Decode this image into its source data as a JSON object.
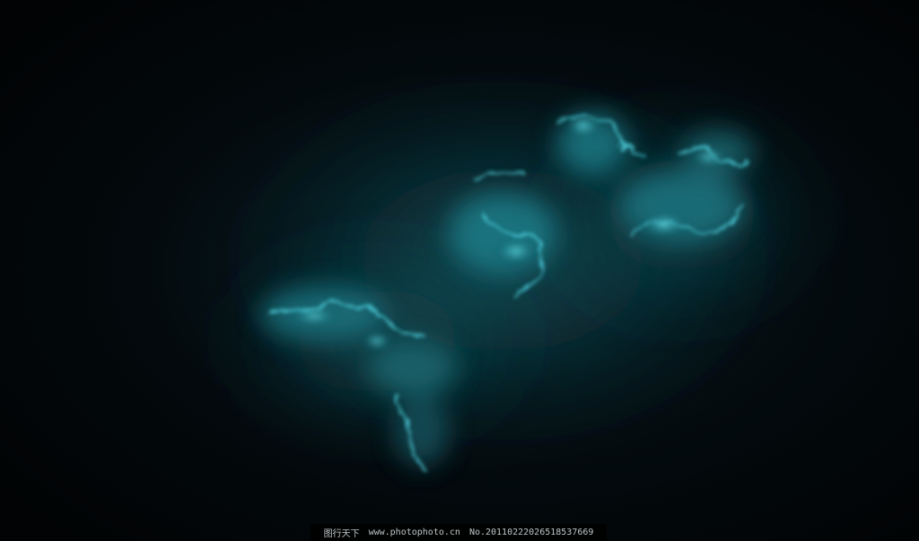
{
  "watermark": {
    "site_name": "图行天下",
    "url": "www.photophoto.cn",
    "image_no": "No.20110222026518537669"
  },
  "colors": {
    "background": "#020608",
    "nebula_glow": "#4fd3e0",
    "nebula_mid": "#1f7f8a",
    "nebula_dim": "#0c3a42"
  }
}
